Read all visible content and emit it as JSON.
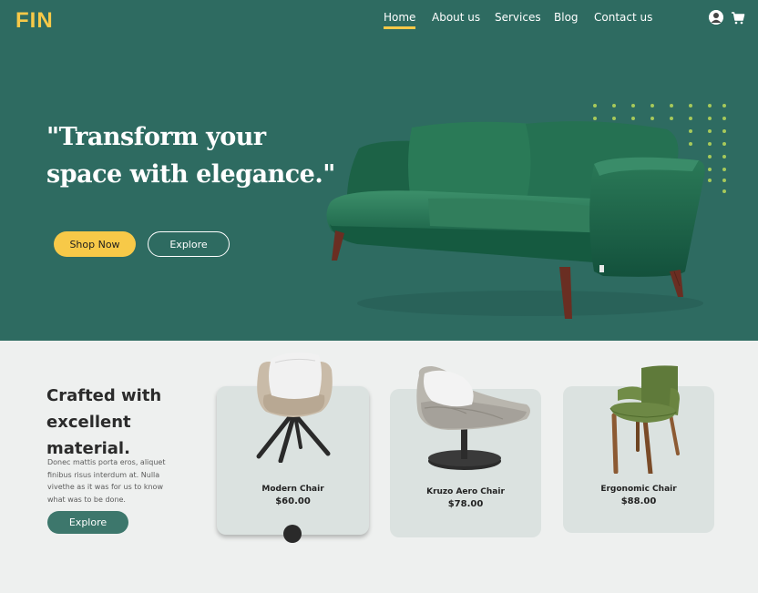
{
  "brand": {
    "logo_text": "FIN",
    "accent": "#f7c948",
    "hero_bg": "#2e6b61"
  },
  "nav": {
    "items": [
      {
        "label": "Home",
        "active": true
      },
      {
        "label": "About us"
      },
      {
        "label": "Services"
      },
      {
        "label": "Blog"
      },
      {
        "label": "Contact us"
      }
    ],
    "icons": [
      "user-icon",
      "cart-icon"
    ]
  },
  "hero": {
    "headline": "\"Transform your space with elegance.\"",
    "primary_button": "Shop Now",
    "secondary_button": "Explore"
  },
  "section": {
    "title": "Crafted with excellent material.",
    "description": "Donec mattis porta eros, aliquet finibus risus interdum at. Nulla vivethe as it was for us to know what was to be done.",
    "button": "Explore"
  },
  "products": [
    {
      "name": "Modern Chair",
      "price": "$60.00"
    },
    {
      "name": "Kruzo Aero Chair",
      "price": "$78.00"
    },
    {
      "name": "Ergonomic Chair",
      "price": "$88.00"
    }
  ]
}
